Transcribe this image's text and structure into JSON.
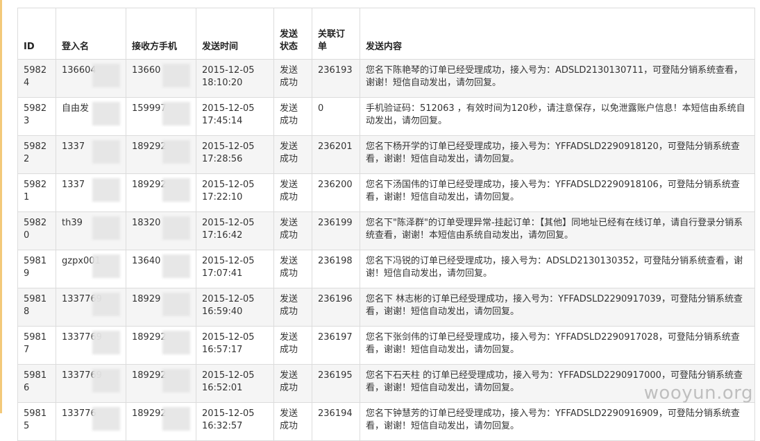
{
  "table": {
    "headers": {
      "id": "ID",
      "login": "登入名",
      "phone": "接收方手机",
      "time": "发送时间",
      "status": "发送\n状态",
      "order": "关联订\n单",
      "content": "发送内容"
    },
    "rows": [
      {
        "id": "59824",
        "login": "136604",
        "phone": "13660",
        "time": "2015-12-05\n18:10:20",
        "status": "发送\n成功",
        "order": "236193",
        "content": "您名下陈艳琴的订单已经受理成功，接入号为：ADSLD2130130711，可登陆分销系统查看，谢谢！短信自动发出，请勿回复。"
      },
      {
        "id": "59823",
        "login": "自由发",
        "phone": "159997",
        "time": "2015-12-05\n17:45:14",
        "status": "发送\n成功",
        "order": "0",
        "content": "手机验证码：512063 ，有效时间为120秒，请注意保存，以免泄露账户信息！本短信由系统自动发出，请勿回复。"
      },
      {
        "id": "59822",
        "login": "1337",
        "phone": "189292",
        "time": "2015-12-05\n17:28:56",
        "status": "发送\n成功",
        "order": "236201",
        "content": "您名下杨开学的订单已经受理成功，接入号为：YFFADSLD2290918120，可登陆分销系统查看，谢谢！短信自动发出，请勿回复。"
      },
      {
        "id": "59821",
        "login": "1337",
        "phone": "189292",
        "time": "2015-12-05\n17:22:10",
        "status": "发送\n成功",
        "order": "236200",
        "content": "您名下汤国伟的订单已经受理成功，接入号为：YFFADSLD2290918106，可登陆分销系统查看，谢谢！短信自动发出，请勿回复。"
      },
      {
        "id": "59820",
        "login": "th39",
        "phone": "18320",
        "time": "2015-12-05\n17:16:42",
        "status": "发送\n成功",
        "order": "236199",
        "content": "您名下\"陈泽群\"的订单受理异常-挂起订单：【其他】同地址已经有在线订单，请自行登录分销系统查看，谢谢！本短信由系统自动发出，请勿回复。"
      },
      {
        "id": "59819",
        "login": "gzpx001",
        "phone": "13640",
        "time": "2015-12-05\n17:07:41",
        "status": "发送\n成功",
        "order": "236198",
        "content": "您名下冯锐的订单已经受理成功，接入号为：ADSLD2130130352，可登陆分销系统查看，谢谢！短信自动发出，请勿回复。"
      },
      {
        "id": "59818",
        "login": "1337769",
        "phone": "18929",
        "time": "2015-12-05\n16:59:40",
        "status": "发送\n成功",
        "order": "236196",
        "content": "您名下 林志彬的订单已经受理成功，接入号为：YFFADSLD2290917039，可登陆分销系统查看，谢谢！短信自动发出，请勿回复。"
      },
      {
        "id": "59817",
        "login": "1337769",
        "phone": "189292",
        "time": "2015-12-05\n16:57:17",
        "status": "发送\n成功",
        "order": "236197",
        "content": "您名下张剑伟的订单已经受理成功，接入号为：YFFADSLD2290917028，可登陆分销系统查看，谢谢！短信自动发出，请勿回复。"
      },
      {
        "id": "59816",
        "login": "1337769",
        "phone": "189292",
        "time": "2015-12-05\n16:52:01",
        "status": "发送\n成功",
        "order": "236195",
        "content": "您名下石天柱 的订单已经受理成功，接入号为：YFFADSLD2290917000，可登陆分销系统查看，谢谢！短信自动发出，请勿回复。"
      },
      {
        "id": "59815",
        "login": "133776",
        "phone": "189292",
        "time": "2015-12-05\n16:32:57",
        "status": "发送\n成功",
        "order": "236194",
        "content": "您名下钟慧芳的订单已经受理成功，接入号为：YFFADSLD2290916909，可登陆分销系统查看，谢谢！短信自动发出，请勿回复。"
      }
    ]
  },
  "watermark": "wooyun.org"
}
